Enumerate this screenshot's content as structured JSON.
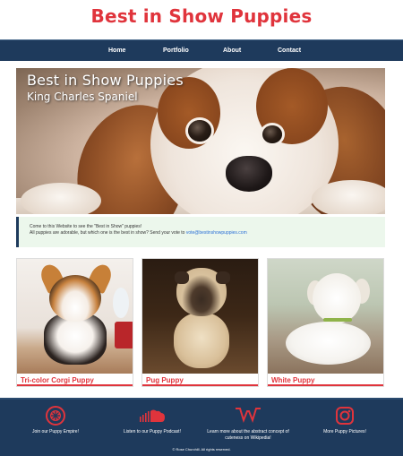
{
  "site": {
    "title": "Best in Show Puppies"
  },
  "nav": {
    "items": [
      "Home",
      "Portfolio",
      "About",
      "Contact"
    ]
  },
  "hero": {
    "title": "Best in Show Puppies",
    "subtitle": "King Charles Spaniel"
  },
  "intro": {
    "line1": "Come to this Website to see the \"Best in Show\" puppies!",
    "line2_prefix": "All puppies are adorable, but which one is the best in show? Send your vote to ",
    "email": "vote@bestinshowpuppies.com"
  },
  "cards": [
    {
      "caption": "Tri-color Corgi Puppy"
    },
    {
      "caption": "Pug Puppy"
    },
    {
      "caption": "White Puppy"
    }
  ],
  "footer": {
    "items": [
      {
        "icon": "pinterest-icon",
        "label": "Join our Puppy Empire!"
      },
      {
        "icon": "soundcloud-icon",
        "label": "Listen to our Puppy Podcast!"
      },
      {
        "icon": "wikipedia-icon",
        "label": "Learn more about the abstract concept of cuteness on Wikipedia!"
      },
      {
        "icon": "instagram-icon",
        "label": "More Puppy Pictures!"
      }
    ],
    "copyright": "© Rose Churchill. All rights reserved."
  },
  "colors": {
    "brand_red": "#e0343c",
    "navy": "#1e3a5c",
    "intro_bg": "#ecf7ec",
    "link_blue": "#2a6fd6"
  }
}
